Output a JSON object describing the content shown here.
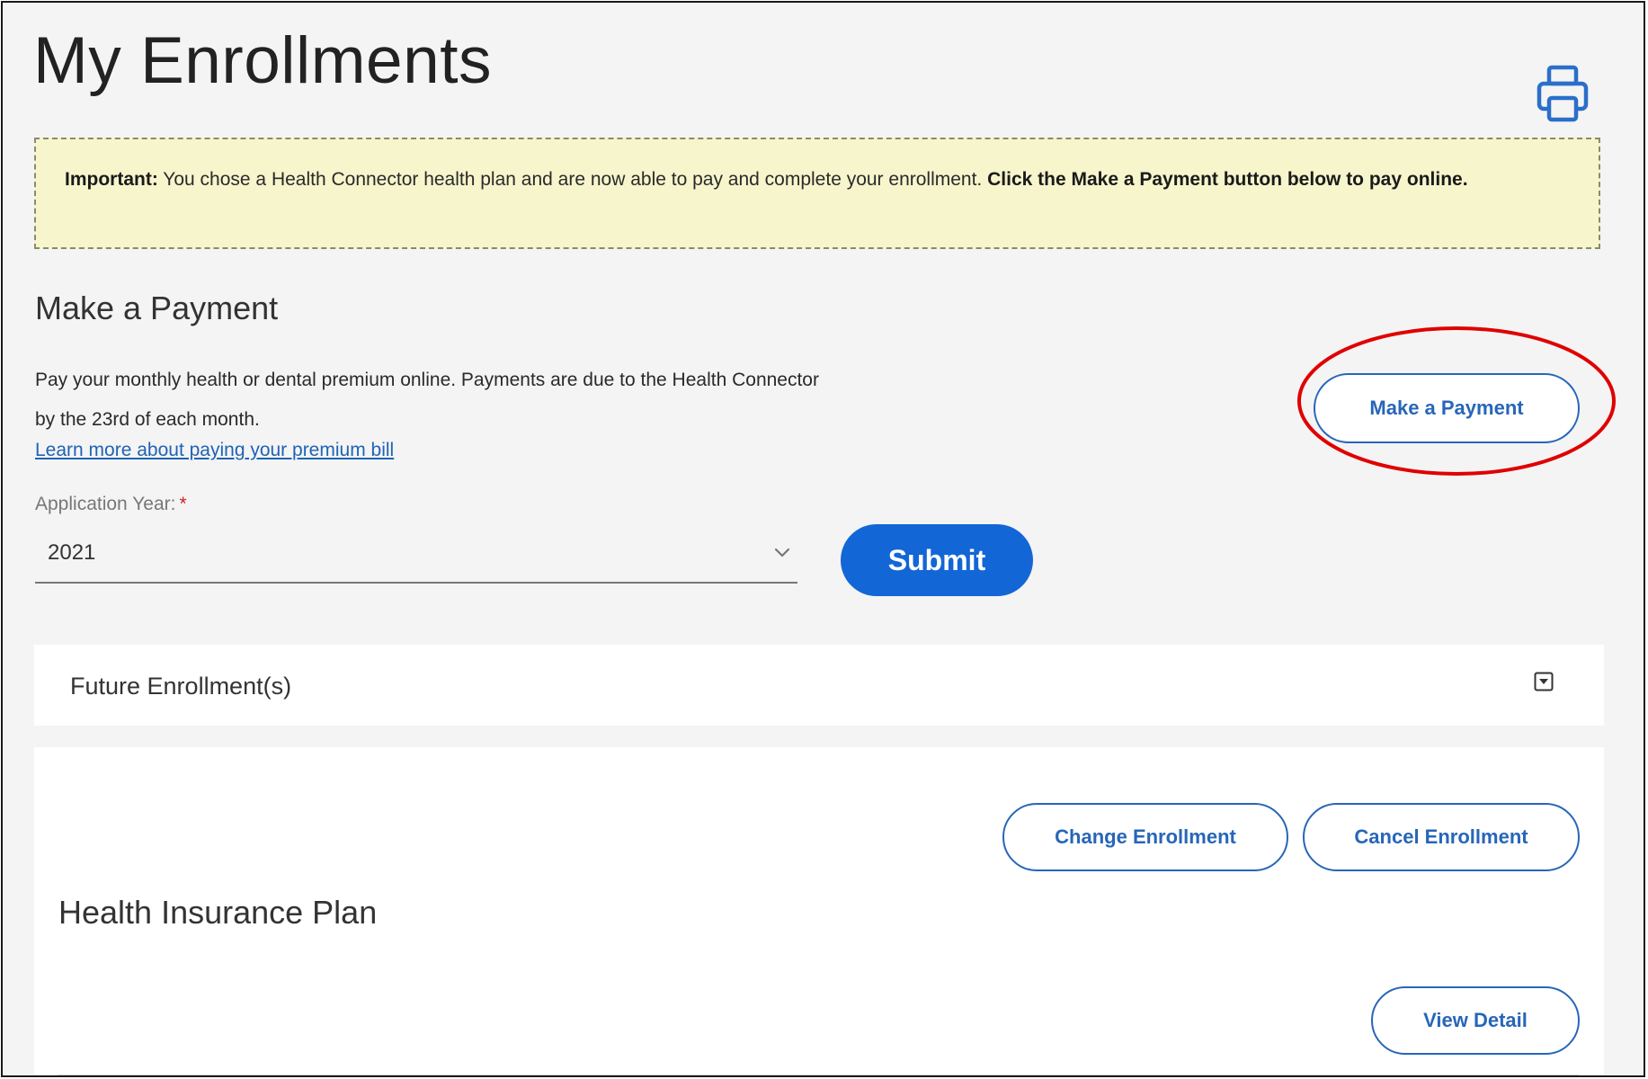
{
  "header": {
    "title": "My Enrollments",
    "print_icon": "printer-icon"
  },
  "notice": {
    "label": "Important:",
    "text": " You chose a Health Connector health plan and are now able to pay and complete your enrollment. ",
    "emphasis": "Click the Make a Payment button below to pay online."
  },
  "payment": {
    "title": "Make a Payment",
    "description_line1": "Pay your monthly health or dental premium online. Payments are due to the Health Connector",
    "description_line2": "by the 23rd of each month.",
    "learn_link": "Learn more about paying your premium bill",
    "button_label": "Make a Payment",
    "year_label": "Application Year:",
    "required_mark": "*",
    "year_value": "2021",
    "submit_label": "Submit"
  },
  "future_enrollments": {
    "title": "Future Enrollment(s)",
    "toggle_icon": "collapse-toggle-icon"
  },
  "plan": {
    "change_label": "Change Enrollment",
    "cancel_label": "Cancel Enrollment",
    "title": "Health Insurance Plan",
    "view_detail_label": "View Detail"
  },
  "colors": {
    "primary_blue": "#1366d6",
    "outline_blue": "#2766b8",
    "link_blue": "#1f63b5",
    "notice_background": "#f7f5cc",
    "highlight_red": "#e00000",
    "required_red": "#d02020",
    "page_background": "#f4f4f4"
  }
}
